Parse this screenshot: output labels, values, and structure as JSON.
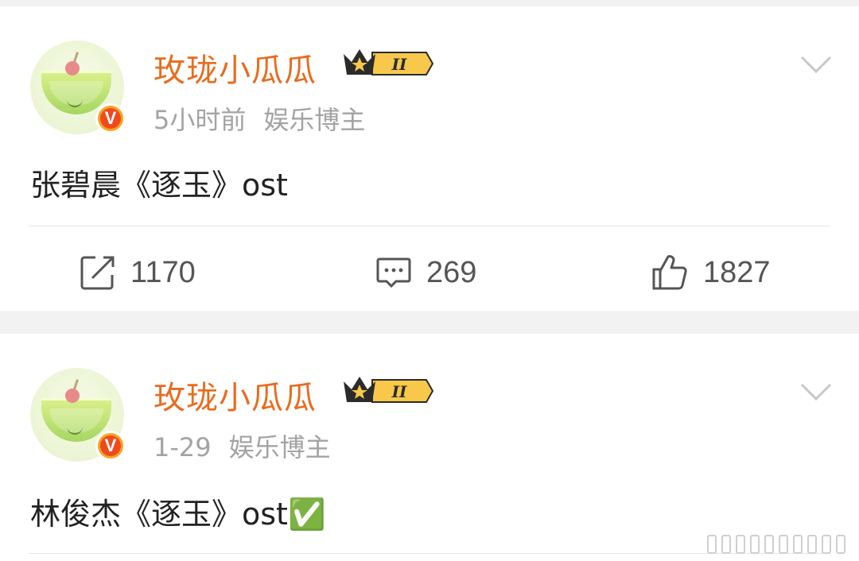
{
  "posts": [
    {
      "username": "玫珑小瓜瓜",
      "level_badge": "II",
      "time": "5小时前",
      "tag": "娱乐博主",
      "content": "张碧晨《逐玉》ost",
      "repost_count": "1170",
      "comment_count": "269",
      "like_count": "1827"
    },
    {
      "username": "玫珑小瓜瓜",
      "level_badge": "II",
      "time": "1-29",
      "tag": "娱乐博主",
      "content": "林俊杰《逐玉》ost✅"
    }
  ],
  "colors": {
    "username": "#e86c1f",
    "meta": "#a3a3a3",
    "verified_badge": "#f04a1c",
    "background": "#f2f2f2"
  },
  "icons": [
    "avatar-melon",
    "verified-v-icon",
    "crown-level-icon",
    "chevron-down-icon",
    "repost-icon",
    "comment-icon",
    "like-icon"
  ]
}
